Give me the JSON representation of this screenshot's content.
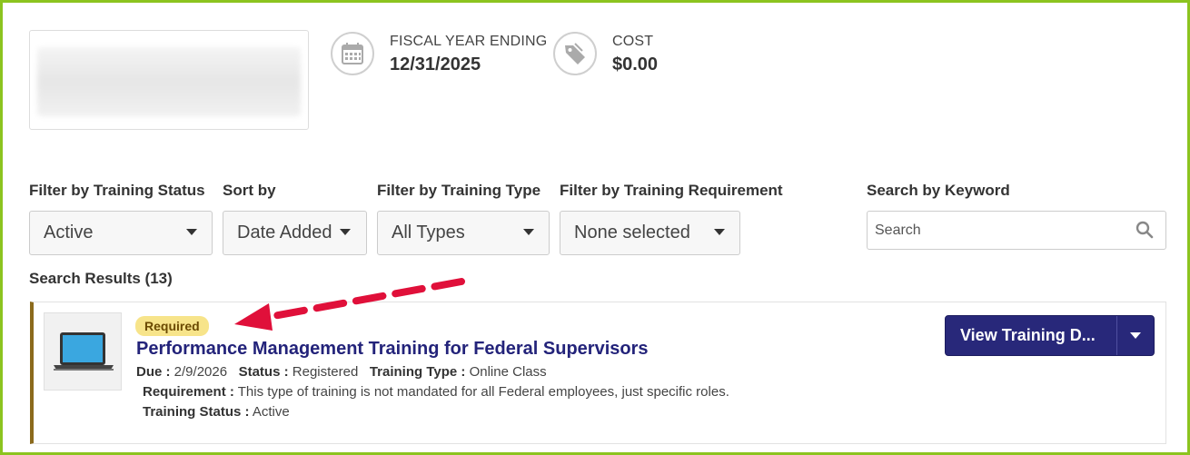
{
  "header": {
    "fiscal": {
      "label": "FISCAL YEAR ENDING",
      "value": "12/31/2025",
      "icon": "calendar-icon"
    },
    "cost": {
      "label": "COST",
      "value": "$0.00",
      "icon": "price-tag-icon"
    }
  },
  "filters": {
    "status": {
      "label": "Filter by Training Status",
      "value": "Active"
    },
    "sort": {
      "label": "Sort by",
      "value": "Date Added"
    },
    "type": {
      "label": "Filter by Training Type",
      "value": "All Types"
    },
    "requirement": {
      "label": "Filter by Training Requirement",
      "value": "None selected"
    },
    "keyword": {
      "label": "Search by Keyword",
      "placeholder": "Search"
    }
  },
  "results": {
    "label": "Search Results (13)"
  },
  "card": {
    "badge": "Required",
    "title": "Performance Management Training for Federal Supervisors",
    "due_label": "Due :",
    "due_value": "2/9/2026",
    "status_label": "Status :",
    "status_value": "Registered",
    "type_label": "Training Type :",
    "type_value": "Online Class",
    "requirement_label": "Requirement :",
    "requirement_value": "This type of training is not mandated for all Federal employees, just specific roles.",
    "training_status_label": "Training Status :",
    "training_status_value": "Active",
    "button_label": "View Training D..."
  },
  "colors": {
    "frame": "#8cc41f",
    "accent_button": "#28287a",
    "title": "#23237a",
    "badge_bg": "#f7e48a",
    "arrow": "#e0103a"
  }
}
